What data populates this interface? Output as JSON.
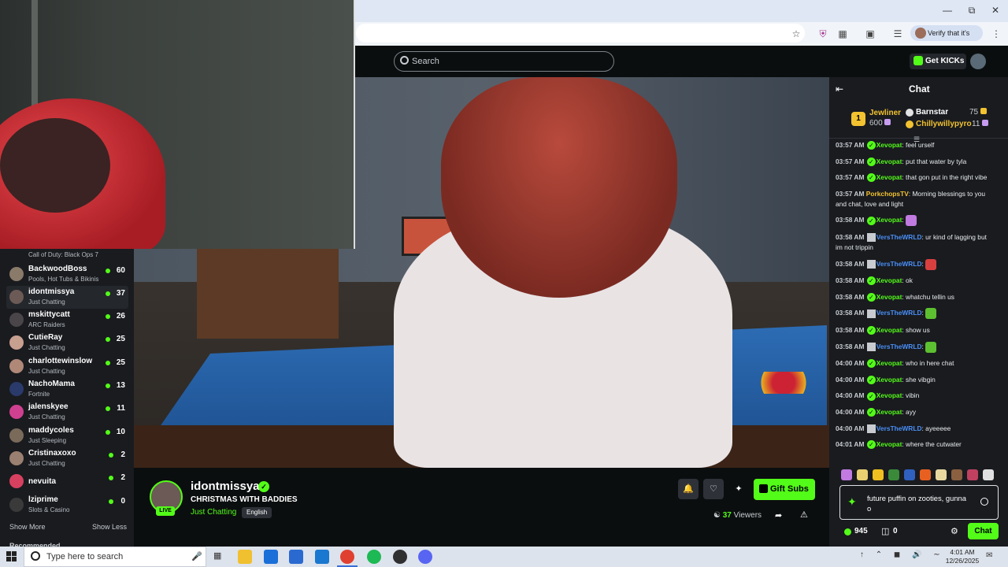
{
  "browser": {
    "verify_label": "Verify that it's you",
    "window_controls": [
      "minimize-icon",
      "restore-icon",
      "close-icon"
    ]
  },
  "header": {
    "search_placeholder": "Search",
    "get_kicks_label": "Get KICKs"
  },
  "sidebar": {
    "partial_item_category": "Call of Duty: Black Ops 7",
    "items": [
      {
        "name": "BackwoodBoss",
        "category": "Pools, Hot Tubs & Bikinis",
        "viewers": "60",
        "color": "#8a7a6a"
      },
      {
        "name": "idontmissya",
        "category": "Just Chatting",
        "viewers": "37",
        "color": "#6b5a55",
        "active": true
      },
      {
        "name": "mskittycatt",
        "category": "ARC Raiders",
        "viewers": "26",
        "color": "#4a4548"
      },
      {
        "name": "CutieRay",
        "category": "Just Chatting",
        "viewers": "25",
        "color": "#c8a090"
      },
      {
        "name": "charlottewinslow",
        "category": "Just Chatting",
        "viewers": "25",
        "color": "#b08878"
      },
      {
        "name": "NachoMama",
        "category": "Fortnite",
        "viewers": "13",
        "color": "#2a3a6a"
      },
      {
        "name": "jalenskyee",
        "category": "Just Chatting",
        "viewers": "11",
        "color": "#d04090"
      },
      {
        "name": "maddycoles",
        "category": "Just Sleeping",
        "viewers": "10",
        "color": "#7a6a5a"
      },
      {
        "name": "Cristinaxoxo",
        "category": "Just Chatting",
        "viewers": "2",
        "color": "#9a8070"
      },
      {
        "name": "nevuita",
        "category": "",
        "viewers": "2",
        "color": "#d84060"
      },
      {
        "name": "lziprime",
        "category": "Slots & Casino",
        "viewers": "0",
        "color": "#3a3a3a"
      }
    ],
    "show_more": "Show More",
    "show_less": "Show Less",
    "recommended": "Recommended"
  },
  "stream": {
    "streamer": "idontmissya",
    "title": "CHRISTMAS WITH BADDIES",
    "category": "Just Chatting",
    "language": "English",
    "live_label": "LIVE",
    "viewers_count": "37",
    "viewers_label": "Viewers",
    "gift_subs_label": "Gift Subs"
  },
  "chat": {
    "title": "Chat",
    "leaderboard": [
      {
        "rank": "1",
        "name": "Jewliner",
        "amount": "600"
      },
      {
        "name": "Barnstar",
        "amount": "75"
      },
      {
        "name": "Chillywillypyro",
        "amount": "11"
      }
    ],
    "messages": [
      {
        "time": "03:57 AM",
        "user": "Xevopat",
        "color": "green",
        "text": "feel urself"
      },
      {
        "time": "03:57 AM",
        "user": "Xevopat",
        "color": "green",
        "text": "put that water by tyla"
      },
      {
        "time": "03:57 AM",
        "user": "Xevopat",
        "color": "green",
        "text": "that gon put in the right vibe"
      },
      {
        "time": "03:57 AM",
        "user": "PorkchopsTV",
        "color": "orange",
        "text": "Morning blessings to you and chat, love and light"
      },
      {
        "time": "03:58 AM",
        "user": "Xevopat",
        "color": "green",
        "text": "",
        "emote": "#c07ae0"
      },
      {
        "time": "03:58 AM",
        "user": "VersTheWRLD",
        "color": "blue",
        "text": "ur kind of lagging but im not trippin"
      },
      {
        "time": "03:58 AM",
        "user": "VersTheWRLD",
        "color": "blue",
        "text": "",
        "emote": "#d84040"
      },
      {
        "time": "03:58 AM",
        "user": "Xevopat",
        "color": "green",
        "text": "ok"
      },
      {
        "time": "03:58 AM",
        "user": "Xevopat",
        "color": "green",
        "text": "whatchu tellin us"
      },
      {
        "time": "03:58 AM",
        "user": "VersTheWRLD",
        "color": "blue",
        "text": "",
        "emote": "#5cc030"
      },
      {
        "time": "03:58 AM",
        "user": "Xevopat",
        "color": "green",
        "text": "show us"
      },
      {
        "time": "03:58 AM",
        "user": "VersTheWRLD",
        "color": "blue",
        "text": "",
        "emote": "#5cc030"
      },
      {
        "time": "04:00 AM",
        "user": "Xevopat",
        "color": "green",
        "text": "who in here chat"
      },
      {
        "time": "04:00 AM",
        "user": "Xevopat",
        "color": "green",
        "text": "she vibgin"
      },
      {
        "time": "04:00 AM",
        "user": "Xevopat",
        "color": "green",
        "text": "vibin"
      },
      {
        "time": "04:00 AM",
        "user": "Xevopat",
        "color": "green",
        "text": "ayy"
      },
      {
        "time": "04:00 AM",
        "user": "VersTheWRLD",
        "color": "blue",
        "text": "ayeeeee"
      },
      {
        "time": "04:01 AM",
        "user": "Xevopat",
        "color": "green",
        "text": "where the cutwater"
      }
    ],
    "emote_bar": [
      "#c07ae0",
      "#e8d070",
      "#f0c020",
      "#3a8a3a",
      "#3060c0",
      "#e86020",
      "#e8d8a0",
      "#8a6040",
      "#c04060",
      "#e0e0e0"
    ],
    "input_text": "future puffin on zooties, gunna o",
    "points": "945",
    "gifts": "0",
    "send_label": "Chat"
  },
  "taskbar": {
    "search_placeholder": "Type here to search",
    "time": "4:01 AM",
    "date": "12/26/2025",
    "apps": [
      "file-explorer-icon",
      "edge-icon",
      "store-icon",
      "mail-icon",
      "chrome-icon",
      "spotify-icon",
      "obs-icon",
      "discord-icon"
    ]
  }
}
